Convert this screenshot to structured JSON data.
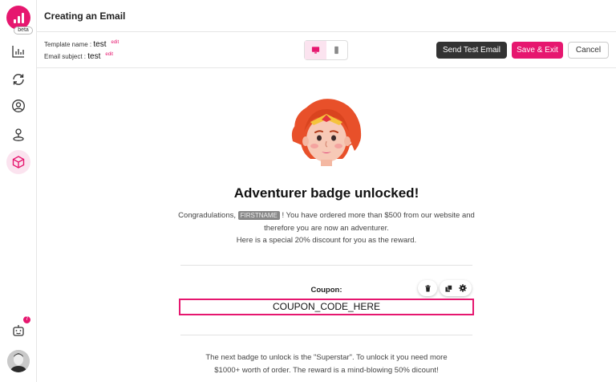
{
  "app": {
    "beta_label": "beta",
    "brand_color": "#e6176f",
    "notification_count": "7"
  },
  "sidebar": {
    "items": [
      {
        "name": "analytics",
        "icon": "bar-chart-icon"
      },
      {
        "name": "sync",
        "icon": "refresh-icon"
      },
      {
        "name": "audience",
        "icon": "user-circle-icon"
      },
      {
        "name": "badges",
        "icon": "person-pin-icon"
      },
      {
        "name": "campaigns",
        "icon": "cube-icon",
        "active": true
      }
    ]
  },
  "header": {
    "title": "Creating an Email"
  },
  "toolbar": {
    "template_name_label": "Template name : ",
    "template_name_value": "test",
    "email_subject_label": "Email subject : ",
    "email_subject_value": "test",
    "edit_label": "edit",
    "send_test_label": "Send Test Email",
    "save_exit_label": "Save & Exit",
    "cancel_label": "Cancel"
  },
  "email": {
    "heading": "Adventurer badge unlocked!",
    "greeting_prefix": "Congradulations, ",
    "firstname_tag": "FIRSTNAME",
    "greeting_suffix": " ! You have ordered more than $500 from our website and therefore you are now an adventurer.",
    "discount_line": "Here is a special 20% discount for you as the reward.",
    "coupon_label": "Coupon:",
    "coupon_code": "COUPON_CODE_HERE",
    "footer_line1": "The next badge to unlock is the \"Superstar\". To unlock it you need more",
    "footer_line2": "$1000+ worth of order. The reward is a mind-blowing 50% dicount!"
  }
}
